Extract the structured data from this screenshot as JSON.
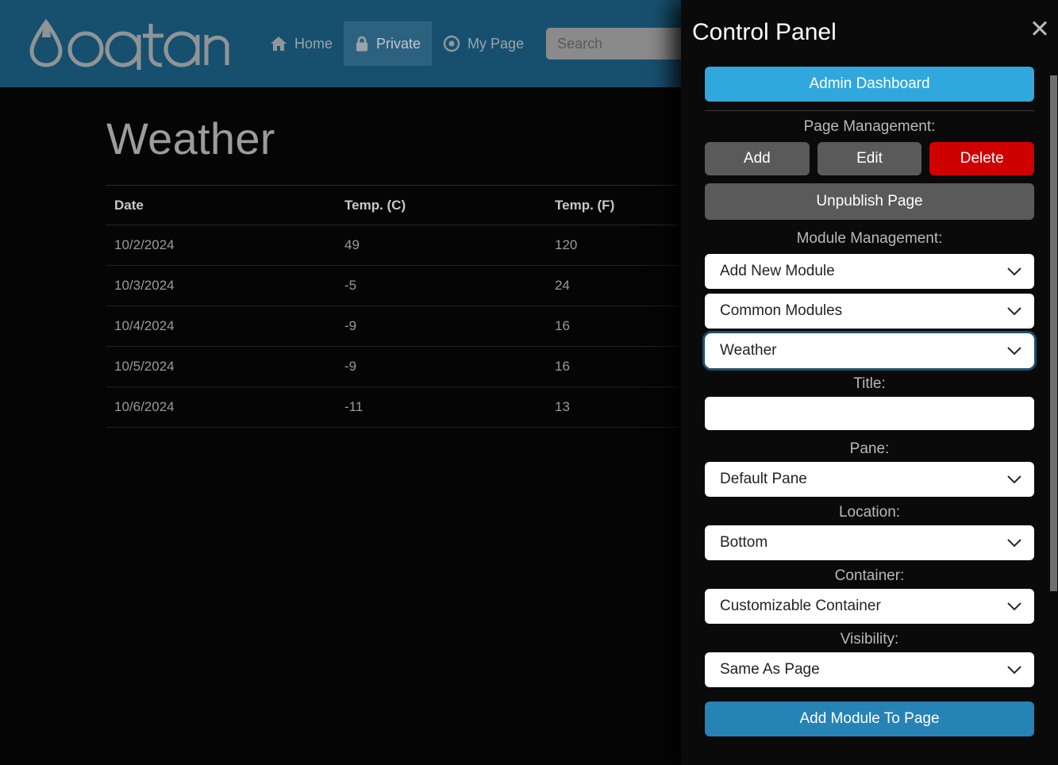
{
  "site": {
    "logo_text": "oqtane",
    "nav": [
      {
        "label": "Home",
        "icon": "home-icon",
        "active": false
      },
      {
        "label": "Private",
        "icon": "lock-icon",
        "active": true
      },
      {
        "label": "My Page",
        "icon": "target-icon",
        "active": false
      }
    ],
    "search": {
      "value": "",
      "placeholder": "Search"
    },
    "page_title": "Weather",
    "table": {
      "columns": [
        "Date",
        "Temp. (C)",
        "Temp. (F)"
      ],
      "rows": [
        [
          "10/2/2024",
          "49",
          "120"
        ],
        [
          "10/3/2024",
          "-5",
          "24"
        ],
        [
          "10/4/2024",
          "-9",
          "16"
        ],
        [
          "10/5/2024",
          "-9",
          "16"
        ],
        [
          "10/6/2024",
          "-11",
          "13"
        ]
      ]
    }
  },
  "control_panel": {
    "title": "Control Panel",
    "close_label": "✕",
    "admin_dashboard_label": "Admin Dashboard",
    "page_management": {
      "label": "Page Management:",
      "add_label": "Add",
      "edit_label": "Edit",
      "delete_label": "Delete",
      "unpublish_label": "Unpublish Page"
    },
    "module_management": {
      "label": "Module Management:",
      "add_new_module": "Add New Module",
      "common_modules": "Common Modules",
      "module": "Weather"
    },
    "fields": {
      "title_label": "Title:",
      "title_value": "",
      "pane_label": "Pane:",
      "pane_value": "Default Pane",
      "location_label": "Location:",
      "location_value": "Bottom",
      "container_label": "Container:",
      "container_value": "Customizable Container",
      "visibility_label": "Visibility:",
      "visibility_value": "Same As Page"
    },
    "add_module_label": "Add Module To Page"
  },
  "colors": {
    "header_bg": "#17506e",
    "accent_blue": "#30a8dd",
    "accent_blue_dark": "#2683b5",
    "danger_red": "#d00000",
    "neutral_grey": "#5a5a5a",
    "page_bg": "#050505"
  }
}
